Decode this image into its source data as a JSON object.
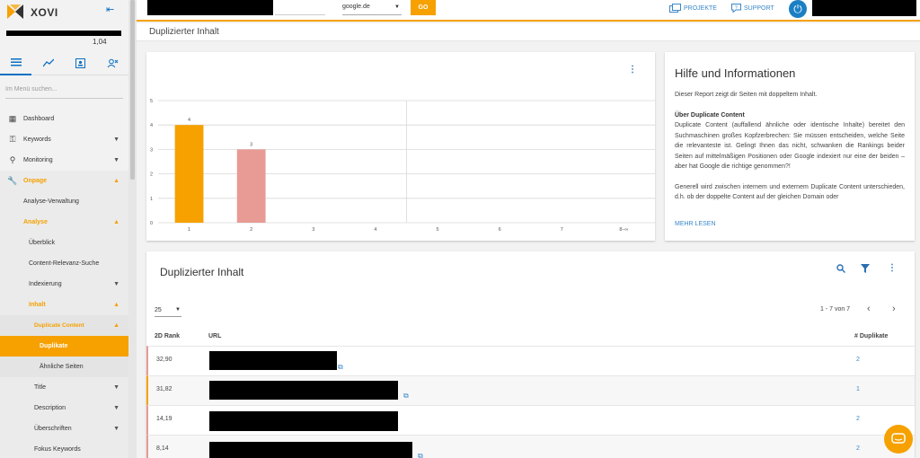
{
  "app": {
    "name": "XOVI"
  },
  "sidebar": {
    "score": "1,04",
    "search_placeholder": "Im Menü suchen...",
    "items": [
      {
        "label": "Dashboard"
      },
      {
        "label": "Keywords"
      },
      {
        "label": "Monitoring"
      },
      {
        "label": "Onpage"
      },
      {
        "label": "Analyse-Verwaltung"
      },
      {
        "label": "Analyse"
      },
      {
        "label": "Überblick"
      },
      {
        "label": "Content-Relevanz-Suche"
      },
      {
        "label": "Indexierung"
      },
      {
        "label": "Inhalt"
      },
      {
        "label": "Duplicate Content"
      },
      {
        "label": "Duplikate"
      },
      {
        "label": "Ähnliche Seiten"
      },
      {
        "label": "Title"
      },
      {
        "label": "Description"
      },
      {
        "label": "Überschriften"
      },
      {
        "label": "Fokus Keywords"
      }
    ]
  },
  "topbar": {
    "search_engine": "google.de",
    "go_label": "GO",
    "projects_label": "PROJEKTE",
    "support_label": "SUPPORT"
  },
  "page": {
    "title": "Duplizierter Inhalt"
  },
  "chart_data": {
    "type": "bar",
    "categories": [
      "1",
      "2",
      "3",
      "4",
      "5",
      "6",
      "7",
      "8–∞"
    ],
    "values": [
      4,
      3,
      null,
      null,
      null,
      null,
      null,
      null
    ],
    "value_labels": [
      "4",
      "3"
    ],
    "bar_colors": [
      "#f6a100",
      "#e89a94"
    ],
    "yticks": [
      "0",
      "1",
      "2",
      "3",
      "4",
      "5"
    ],
    "ylim": [
      0,
      5
    ],
    "grid": true
  },
  "info": {
    "title": "Hilfe und Informationen",
    "intro": "Dieser Report zeigt dir Seiten mit doppeltem Inhalt.",
    "section_title": "Über Duplicate Content",
    "para1": "Duplicate Content (auffallend ähnliche oder identische Inhalte) bereitet den Suchmaschinen großes Kopfzerbrechen: Sie müssen entscheiden, welche Seite die relevanteste ist. Gelingt Ihnen das nicht, schwanken die Rankings beider Seiten auf mittelmäßigen Positionen oder Google indexiert nur eine der beiden – aber hat Google die richtige genommen?!",
    "para2": "Generell wird zwischen internem und externem Duplicate Content unterschieden, d.h. ob der doppelte Content auf der gleichen Domain oder",
    "more_label": "MEHR LESEN"
  },
  "table": {
    "title": "Duplizierter Inhalt",
    "page_size": "25",
    "range": "1 - 7 von 7",
    "columns": {
      "rank": "2D Rank",
      "url": "URL",
      "dupes": "# Duplikate"
    },
    "rows": [
      {
        "rank": "32,90",
        "dupes": "2"
      },
      {
        "rank": "31,82",
        "dupes": "1"
      },
      {
        "rank": "14,19",
        "dupes": "2"
      },
      {
        "rank": "8,14",
        "dupes": "2"
      }
    ]
  },
  "colors": {
    "accent": "#f6a100",
    "link": "#3a87c8",
    "brand_blue": "#1b7fc4"
  }
}
